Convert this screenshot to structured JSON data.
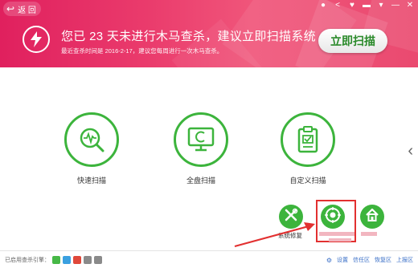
{
  "header": {
    "back_label": "返 回",
    "headline": "您已 23 天未进行木马查杀，建议立即扫描系统",
    "subline": "最近查杀时间是 2016-2-17，建议您每周进行一次木马查杀。",
    "scan_now_label": "立即扫描",
    "window_controls": [
      "●",
      "<",
      "♥",
      "▬",
      "▾",
      "—",
      "✕"
    ]
  },
  "scan_options": [
    {
      "label": "快速扫描",
      "icon": "pulse-monitor-icon"
    },
    {
      "label": "全盘扫描",
      "icon": "computer-monitor-icon"
    },
    {
      "label": "自定义扫描",
      "icon": "custom-checklist-icon"
    }
  ],
  "tools": {
    "system_repair_label": "系统修复"
  },
  "footer": {
    "engine_label": "已启用查杀引擎：",
    "engine_colors": [
      "#47b847",
      "#3aa0e0",
      "#e0483a",
      "#8a8a8a",
      "#8a8a8a"
    ],
    "settings_label": "设置",
    "quarantine_label": "信任区",
    "restore_label": "恢复区",
    "report_label": "上报区"
  },
  "colors": {
    "accent_green": "#3cb43c",
    "header_pink": "#e0205e",
    "highlight_red": "#e23030"
  }
}
